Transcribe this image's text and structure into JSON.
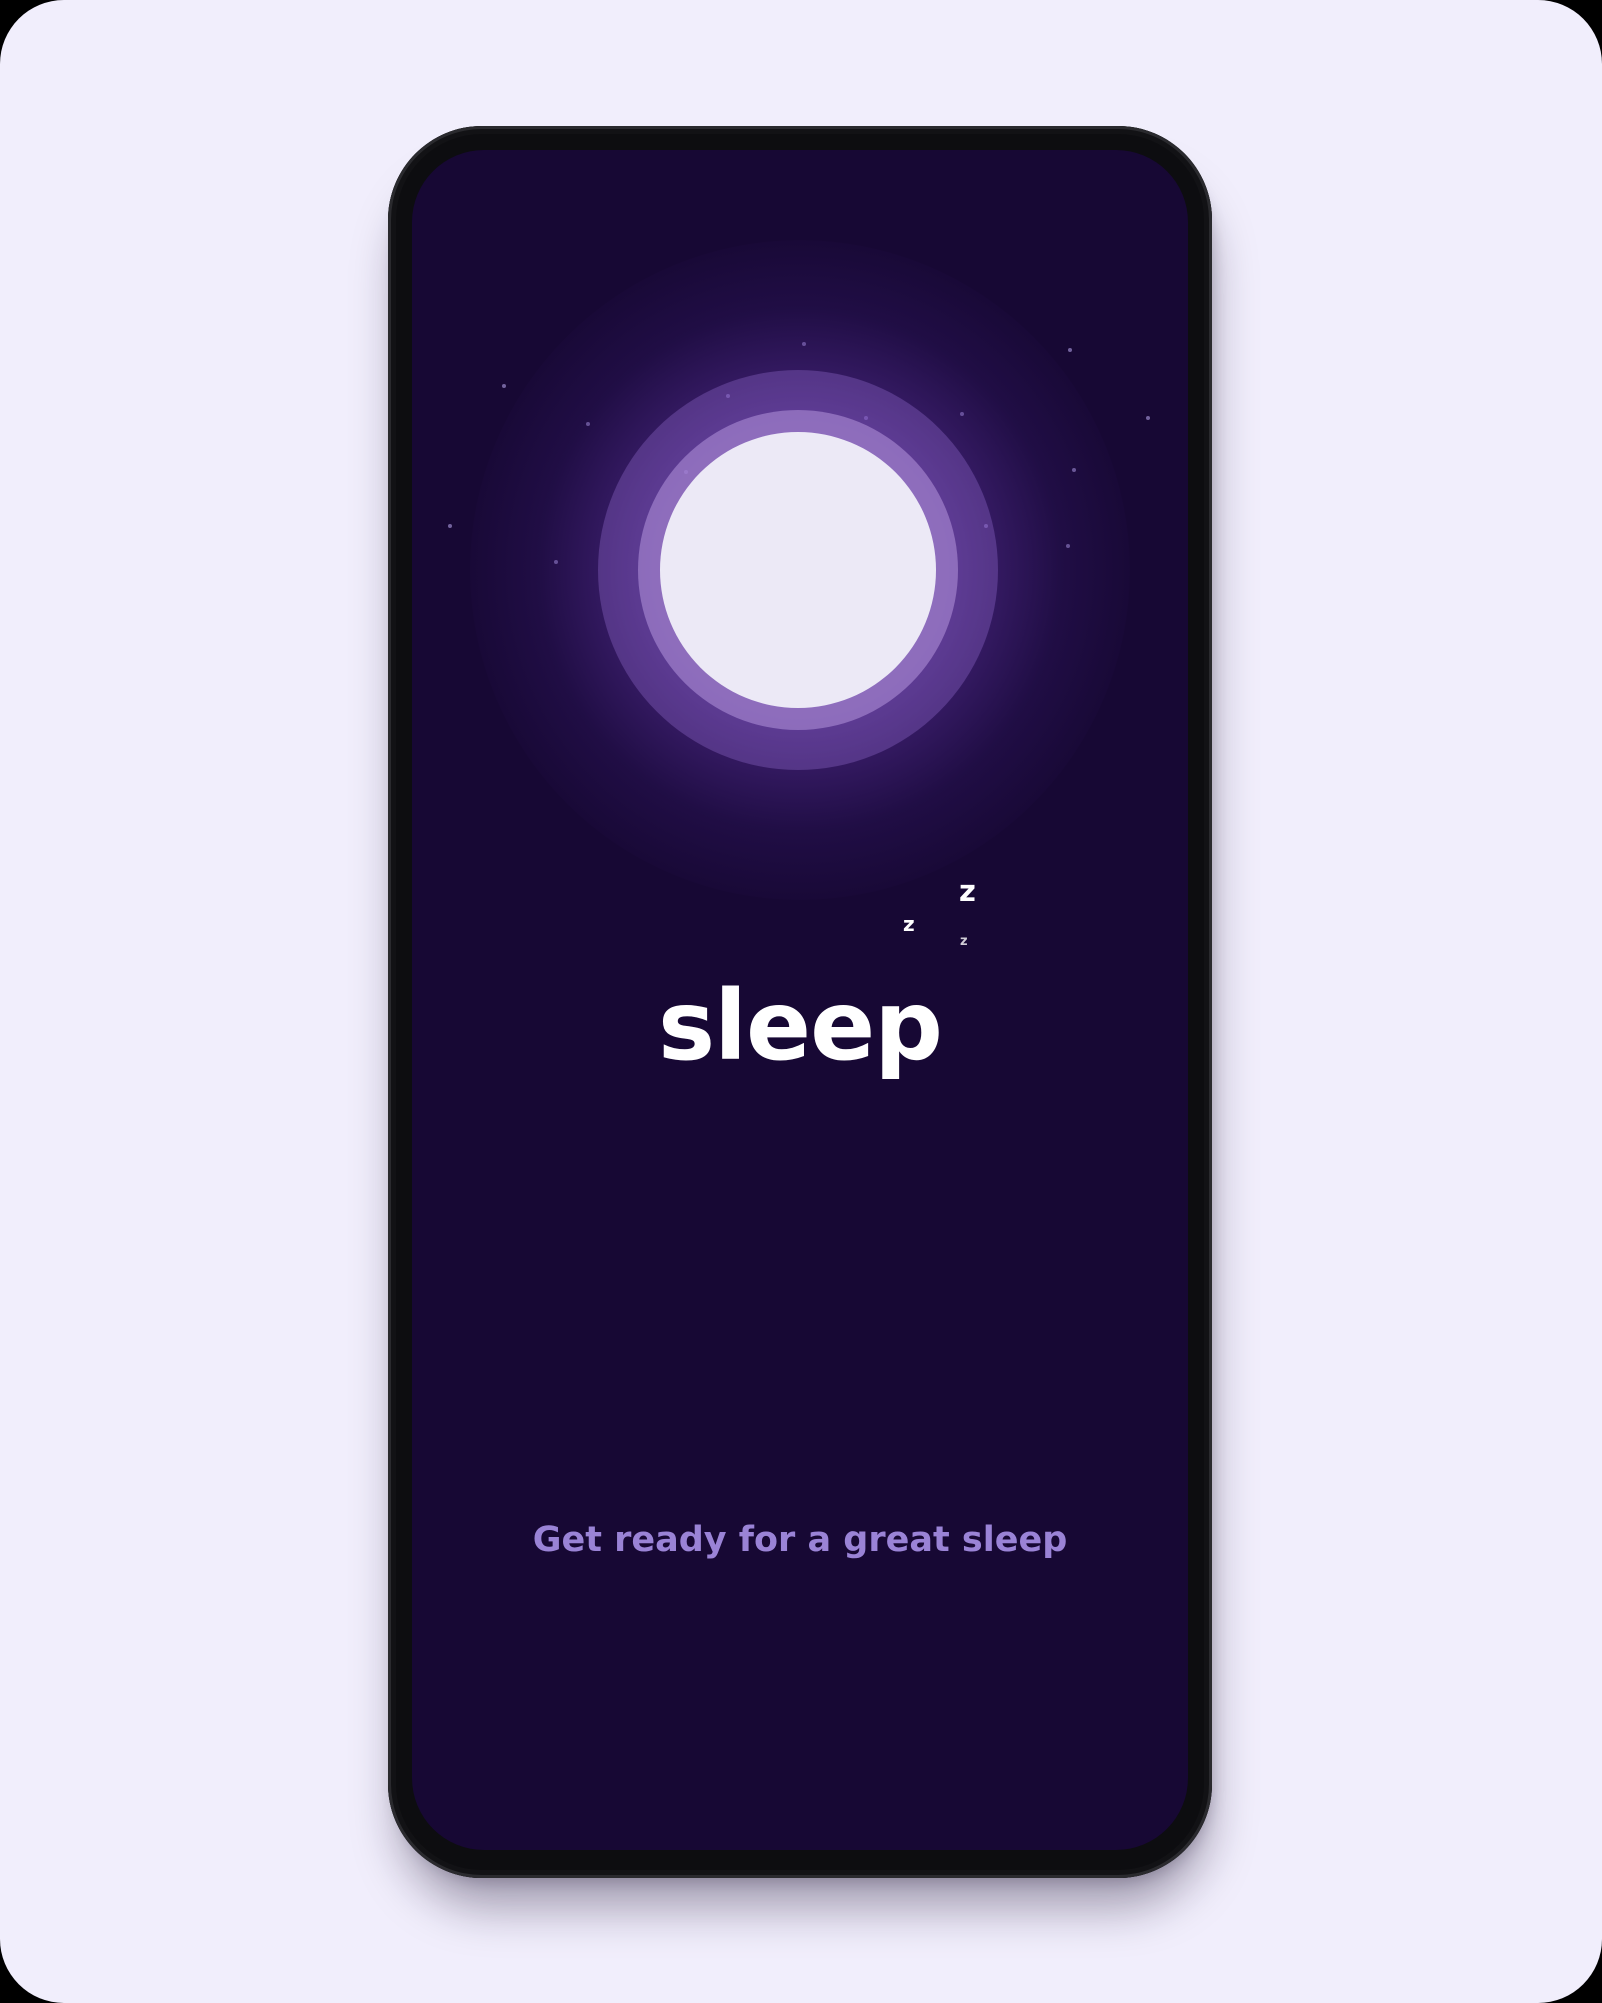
{
  "app": {
    "logo_text": "sleep",
    "zzz": [
      "z",
      "z",
      "z"
    ],
    "tagline": "Get ready for a great sleep"
  },
  "colors": {
    "page_background": "#f1eefc",
    "screen_background": "#170834",
    "moon": "#ece9f6",
    "tagline": "#9a83d6",
    "logo": "#ffffff"
  },
  "icons": {
    "moon": "moon-icon",
    "zzz": "sleep-zzz-icon"
  }
}
